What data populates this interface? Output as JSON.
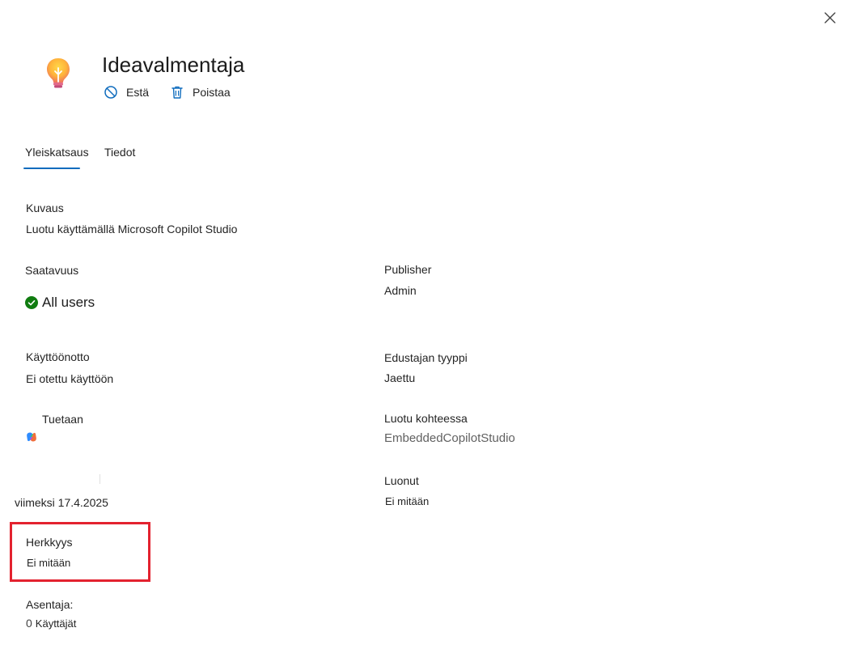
{
  "app": {
    "title": "Ideavalmentaja"
  },
  "commands": {
    "block_label": "Estä",
    "delete_label": "Poistaa"
  },
  "tabs": [
    {
      "label": "Yleiskatsaus",
      "selected": true
    },
    {
      "label": "Tiedot",
      "selected": false
    }
  ],
  "fields": {
    "description": {
      "label": "Kuvaus",
      "value": "Luotu käyttämällä Microsoft Copilot Studio"
    },
    "availability": {
      "label": "Saatavuus",
      "value": "All users"
    },
    "publisher": {
      "label": "Publisher",
      "value": "Admin"
    },
    "deployment": {
      "label": "Käyttöönotto",
      "value": "Ei otettu käyttöön"
    },
    "agent_type": {
      "label": "Edustajan tyyppi",
      "value": "Jaettu"
    },
    "supported": {
      "label": "Tuetaan"
    },
    "created_in": {
      "label": "Luotu kohteessa",
      "value": "EmbeddedCopilotStudio"
    },
    "last_updated": {
      "value": "viimeksi 17.4.2025"
    },
    "created_by": {
      "label": "Luonut",
      "value": "Ei mitään"
    },
    "sensitivity": {
      "label": "Herkkyys",
      "value": "Ei mitään"
    },
    "installer": {
      "label": "Asentaja:",
      "count": "0",
      "unit": "Käyttäjät"
    }
  },
  "colors": {
    "accent": "#0f6cbd",
    "success": "#107c10",
    "highlight": "#e3222f"
  },
  "icons": {
    "close": "close-icon",
    "app": "lightbulb-icon",
    "block": "block-icon",
    "delete": "trash-icon",
    "check": "checkmark-circle-icon",
    "copilot": "copilot-logo-icon"
  }
}
